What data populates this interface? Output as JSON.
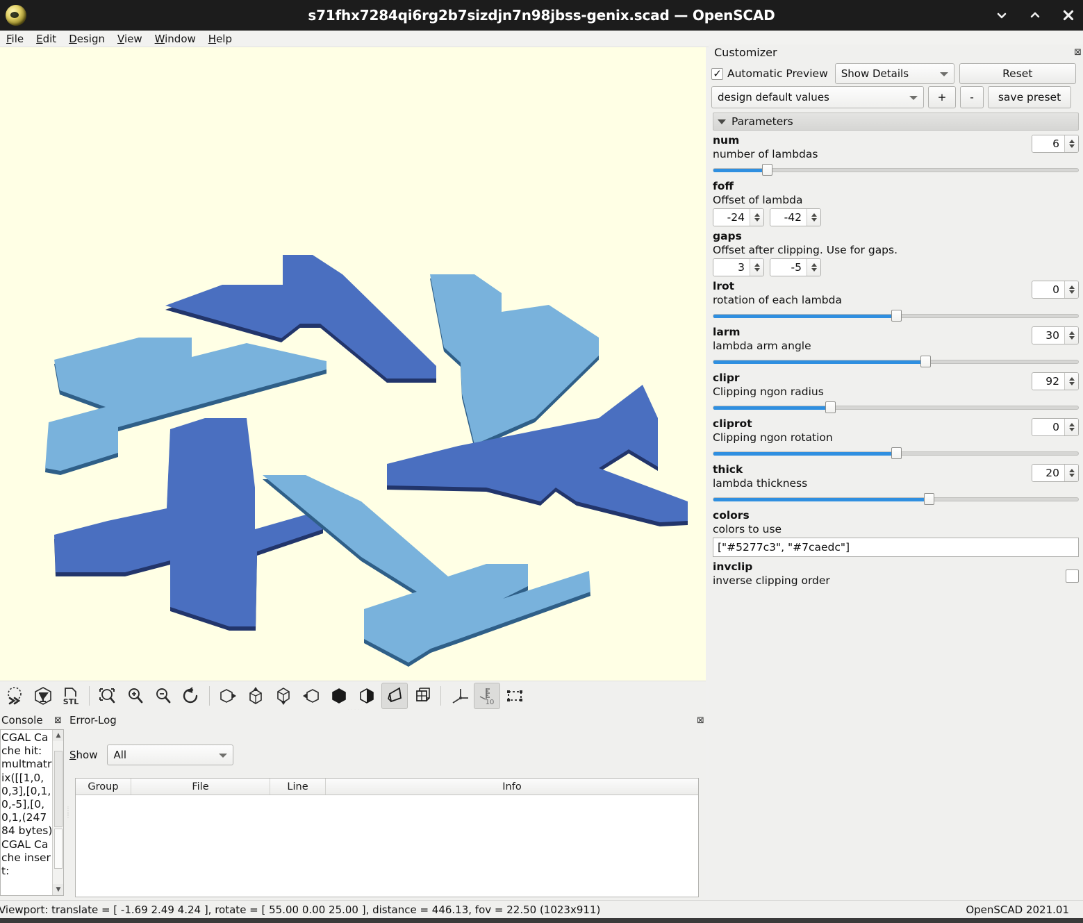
{
  "window": {
    "title": "s71fhx7284qi6rg2b7sizdjn7n98jbss-genix.scad — OpenSCAD",
    "logo_icon": "openscad-logo-icon",
    "controls": [
      {
        "name": "minimize-button",
        "icon": "chevron-down-icon"
      },
      {
        "name": "maximize-button",
        "icon": "chevron-up-icon"
      },
      {
        "name": "close-button",
        "icon": "close-x-icon"
      }
    ]
  },
  "menubar": {
    "items": [
      {
        "mnemonic": "F",
        "rest": "ile"
      },
      {
        "mnemonic": "E",
        "rest": "dit"
      },
      {
        "mnemonic": "D",
        "rest": "esign"
      },
      {
        "mnemonic": "V",
        "rest": "iew"
      },
      {
        "mnemonic": "W",
        "rest": "indow"
      },
      {
        "mnemonic": "H",
        "rest": "elp"
      }
    ]
  },
  "viewport": {
    "background_color": "#ffffe5",
    "color_dark": "#4a6fc0",
    "color_light": "#79b2dc",
    "edge_dark": "#22356b",
    "edge_light": "#2f5f88",
    "model_description": "Six extruded lambda shapes arranged in a snowflake rosette"
  },
  "view_toolbar": {
    "buttons": [
      {
        "name": "preview-button",
        "icon": "preview-dots-icon",
        "active": false
      },
      {
        "name": "render-button",
        "icon": "render-cube-icon",
        "active": false
      },
      {
        "name": "export-stl-button",
        "icon": "stl-export-icon",
        "active": false
      },
      {
        "name": "view-all-button",
        "icon": "zoom-fit-icon",
        "active": false
      },
      {
        "name": "zoom-in-button",
        "icon": "zoom-in-icon",
        "active": false
      },
      {
        "name": "zoom-out-button",
        "icon": "zoom-out-icon",
        "active": false
      },
      {
        "name": "reset-view-button",
        "icon": "reset-rotate-icon",
        "active": false
      },
      {
        "name": "view-right-button",
        "icon": "cube-right-icon",
        "active": false
      },
      {
        "name": "view-top-button",
        "icon": "cube-top-icon",
        "active": false
      },
      {
        "name": "view-bottom-button",
        "icon": "cube-bottom-icon",
        "active": false
      },
      {
        "name": "view-left-button",
        "icon": "cube-left-icon",
        "active": false
      },
      {
        "name": "view-front-button",
        "icon": "cube-front-icon",
        "active": false
      },
      {
        "name": "view-back-button",
        "icon": "cube-back-icon",
        "active": false
      },
      {
        "name": "perspective-button",
        "icon": "perspective-icon",
        "active": true
      },
      {
        "name": "orthogonal-button",
        "icon": "orthogonal-icon",
        "active": false
      },
      {
        "name": "show-axes-button",
        "icon": "axes-icon",
        "active": false
      },
      {
        "name": "show-scale-markers-button",
        "icon": "scale-ruler-icon",
        "active": true
      },
      {
        "name": "show-edges-button",
        "icon": "bounding-box-icon",
        "active": false
      }
    ]
  },
  "dock": {
    "console_title": "Console",
    "console_close_icon": "close-icon",
    "console_text": "CGAL Cache hit: multmatrix([[1,0,0,3],[0,1,0,-5],[0,0,1,(24784 bytes) CGAL Cache insert:",
    "errorlog_title": "Error-Log",
    "errorlog_close_icon": "close-icon",
    "show_label_mnemonic": "S",
    "show_label_rest": "how",
    "show_value": "All",
    "table_headers": [
      "Group",
      "File",
      "Line",
      "Info"
    ],
    "table_rows": []
  },
  "customizer": {
    "title": "Customizer",
    "close_icon": "close-icon",
    "automatic_preview_label": "Automatic Preview",
    "automatic_preview_checked": true,
    "check_glyph": "✓",
    "detail_select_value": "Show Details",
    "reset_label": "Reset",
    "preset_value": "design default values",
    "add_preset_label": "+",
    "remove_preset_label": "-",
    "save_preset_label": "save preset",
    "section_title": "Parameters",
    "parameters": [
      {
        "key": "num",
        "name": "num",
        "desc": "number of lambdas",
        "control": "slider-spin",
        "value": "6",
        "fill_pct": 14.5,
        "knob_pct": 14.5
      },
      {
        "key": "foff",
        "name": "foff",
        "desc": "Offset of lambda",
        "control": "vector2",
        "value1": "-24",
        "value2": "-42"
      },
      {
        "key": "gaps",
        "name": "gaps",
        "desc": "Offset after clipping. Use for gaps.",
        "control": "vector2",
        "value1": "3",
        "value2": "-5"
      },
      {
        "key": "lrot",
        "name": "lrot",
        "desc": "rotation of each lambda",
        "control": "slider-spin",
        "value": "0",
        "fill_pct": 50,
        "knob_pct": 50
      },
      {
        "key": "larm",
        "name": "larm",
        "desc": "lambda arm angle",
        "control": "slider-spin",
        "value": "30",
        "fill_pct": 58,
        "knob_pct": 58
      },
      {
        "key": "clipr",
        "name": "clipr",
        "desc": "Clipping ngon radius",
        "control": "slider-spin",
        "value": "92",
        "fill_pct": 32,
        "knob_pct": 32
      },
      {
        "key": "cliprot",
        "name": "cliprot",
        "desc": "Clipping ngon rotation",
        "control": "slider-spin",
        "value": "0",
        "fill_pct": 50,
        "knob_pct": 50
      },
      {
        "key": "thick",
        "name": "thick",
        "desc": "lambda thickness",
        "control": "slider-spin",
        "value": "20",
        "fill_pct": 59,
        "knob_pct": 59
      },
      {
        "key": "colors",
        "name": "colors",
        "desc": "colors to use",
        "control": "text",
        "value": "[\"#5277c3\", \"#7caedc\"]"
      },
      {
        "key": "invclip",
        "name": "invclip",
        "desc": "inverse clipping order",
        "control": "checkbox",
        "checked": false
      }
    ]
  },
  "statusbar": {
    "viewport_info": "Viewport: translate = [ -1.69 2.49 4.24 ], rotate = [ 55.00 0.00 25.00 ], distance = 446.13, fov = 22.50 (1023x911)",
    "version": "OpenSCAD 2021.01"
  }
}
